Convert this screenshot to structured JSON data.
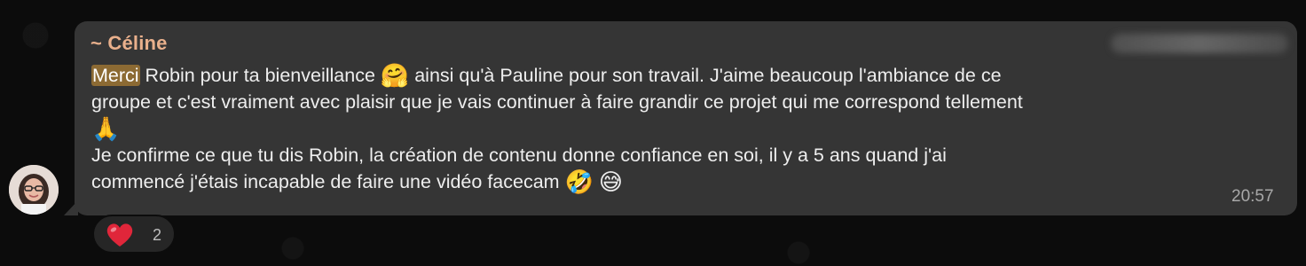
{
  "message": {
    "sender": "~ Céline",
    "lines": [
      {
        "highlight": "Merci",
        "text": " Robin pour ta bienveillance ",
        "emoji": "🤗",
        "after": " ainsi qu'à Pauline pour son travail. J'aime beaucoup l'ambiance de ce"
      },
      {
        "text": "groupe et c'est vraiment avec plaisir que je vais continuer à faire grandir ce projet qui me correspond tellement"
      },
      {
        "emoji": "🙏"
      },
      {
        "text": "Je confirme ce que tu dis Robin, la création de contenu donne confiance en soi, il y a 5 ans quand j'ai"
      },
      {
        "text": "commencé j'étais incapable de faire une vidéo facecam ",
        "emoji": "🤣",
        "emoji2": "😅"
      }
    ],
    "time": "20:57"
  },
  "reaction": {
    "icon": "heart-icon",
    "count": "2",
    "color": "#e0263a"
  },
  "colors": {
    "bubble": "#353535",
    "sender": "#e9b08c",
    "highlight": "#8c6a33"
  }
}
